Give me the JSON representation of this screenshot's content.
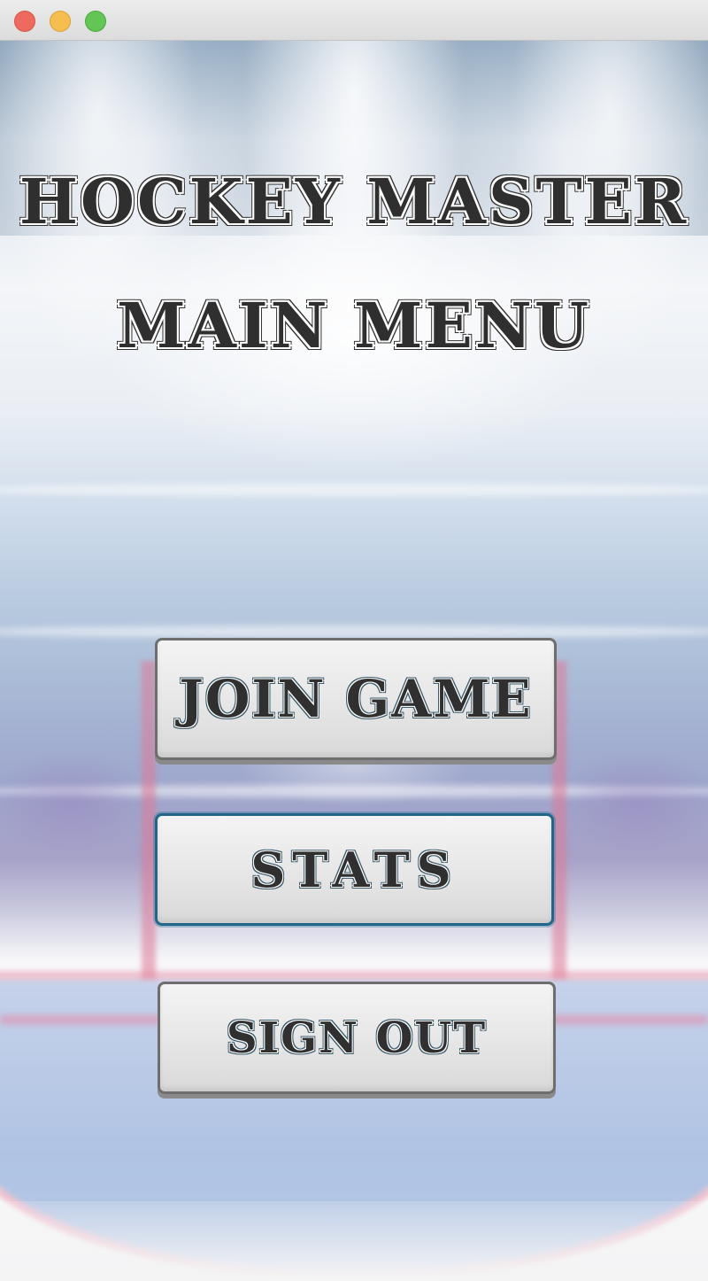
{
  "window": {
    "controls": [
      "close",
      "minimize",
      "maximize"
    ]
  },
  "menu": {
    "title": "HOCKEY MASTER",
    "subtitle": "MAIN MENU",
    "buttons": {
      "join_game": "JOIN GAME",
      "stats": "STATS",
      "sign_out": "SIGN OUT"
    },
    "focused_button": "stats"
  },
  "colors": {
    "heading_text": "#2f2f2f",
    "button_face": "#e6e6e6",
    "button_border": "#6e6e6e",
    "focus_border": "#1f6688",
    "traffic_close": "#ee6a5f",
    "traffic_minimize": "#f5be4f",
    "traffic_maximize": "#62c554"
  }
}
